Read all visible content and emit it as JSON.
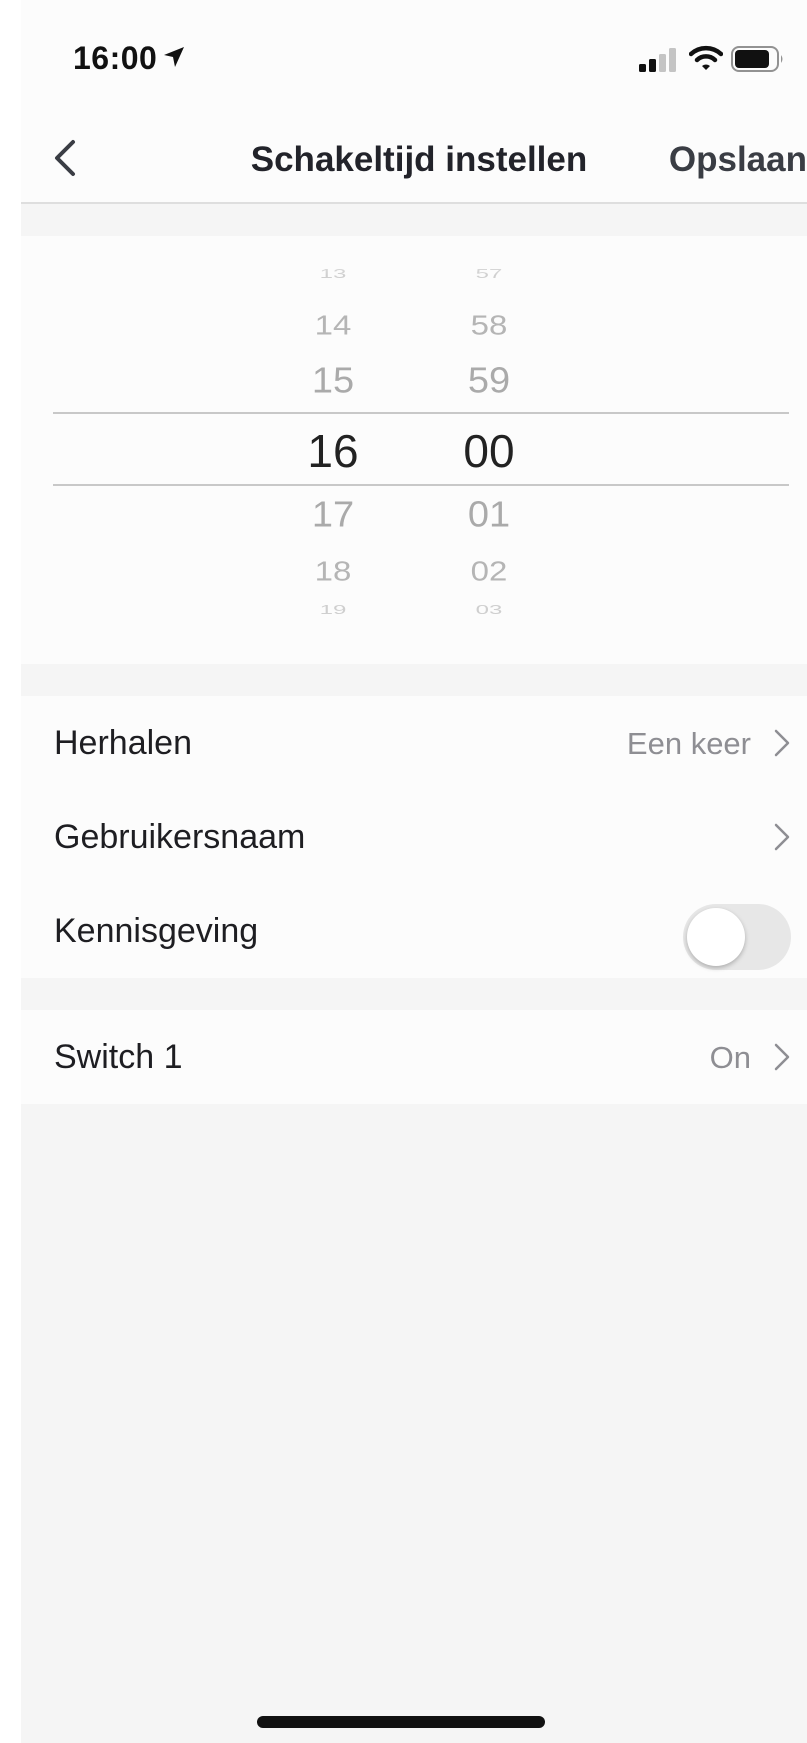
{
  "status_bar": {
    "time": "16:00",
    "icons": [
      "location-arrow-icon",
      "cellular-signal-icon",
      "wifi-icon",
      "battery-icon"
    ]
  },
  "nav": {
    "title": "Schakeltijd instellen",
    "save_label": "Opslaan",
    "back_icon": "chevron-left-icon"
  },
  "picker": {
    "hours": [
      "13",
      "14",
      "15",
      "16",
      "17",
      "18",
      "19"
    ],
    "minutes": [
      "57",
      "58",
      "59",
      "00",
      "01",
      "02",
      "03"
    ],
    "selected_hour": "16",
    "selected_minute": "00"
  },
  "settings": {
    "repeat": {
      "label": "Herhalen",
      "value": "Een keer"
    },
    "username": {
      "label": "Gebruikersnaam"
    },
    "notification": {
      "label": "Kennisgeving",
      "enabled": false
    }
  },
  "switch": {
    "label": "Switch 1",
    "value": "On"
  },
  "colors": {
    "background": "#f5f5f5",
    "surface": "#fcfcfc",
    "text": "#1e1e22",
    "secondary_text": "#8e8e93",
    "toggle_off": "#e7e7e7"
  }
}
